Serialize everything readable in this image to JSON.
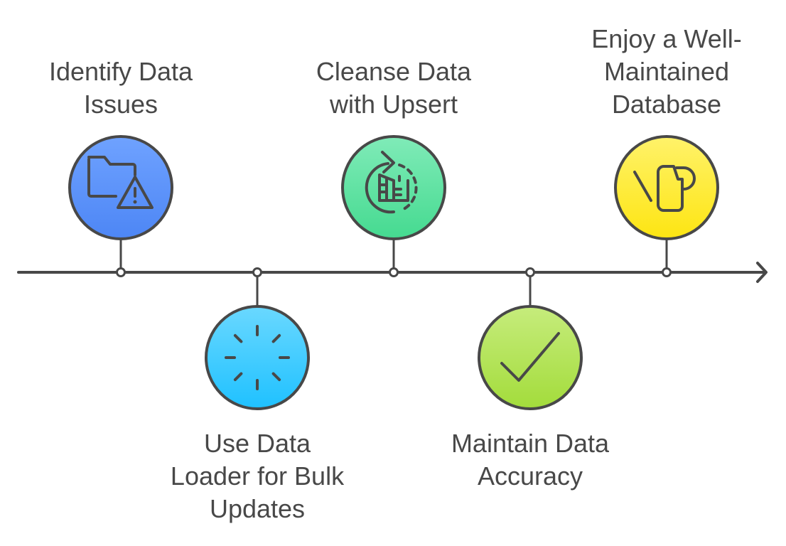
{
  "diagram": {
    "type": "timeline",
    "steps": [
      {
        "id": "identify",
        "label_lines": [
          "Identify Data",
          "Issues"
        ],
        "position": "above",
        "icon": "folder-warning-icon",
        "color_top": "#6fa2ff",
        "color_bottom": "#4d86f5"
      },
      {
        "id": "data-loader",
        "label_lines": [
          "Use Data",
          "Loader for Bulk",
          "Updates"
        ],
        "position": "below",
        "icon": "loading-spinner-icon",
        "color_top": "#6ad8ff",
        "color_bottom": "#1fc1ff"
      },
      {
        "id": "upsert",
        "label_lines": [
          "Cleanse Data",
          "with Upsert"
        ],
        "position": "above",
        "icon": "refresh-cleanse-icon",
        "color_top": "#80ebb8",
        "color_bottom": "#45da90"
      },
      {
        "id": "accuracy",
        "label_lines": [
          "Maintain Data",
          "Accuracy"
        ],
        "position": "below",
        "icon": "checkmark-icon",
        "color_top": "#c6ec7c",
        "color_bottom": "#a3dc3b"
      },
      {
        "id": "enjoy",
        "label_lines": [
          "Enjoy a Well-",
          "Maintained",
          "Database"
        ],
        "position": "above",
        "icon": "watering-can-icon",
        "color_top": "#fff26a",
        "color_bottom": "#fde512"
      }
    ],
    "line_color": "#484848"
  }
}
